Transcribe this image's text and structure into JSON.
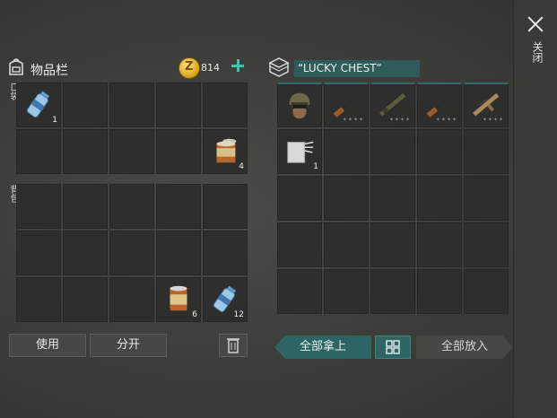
{
  "inventory": {
    "title": "物品栏",
    "coins": "814",
    "pocket_label": "口袋",
    "backpack_label": "背包",
    "pocket_items": [
      {
        "slot": 0,
        "icon": "water-bottle-icon",
        "qty": "1"
      },
      {
        "slot": 9,
        "icon": "open-canned-food-icon",
        "qty": "4"
      }
    ],
    "backpack_items": [
      {
        "slot": 13,
        "icon": "canned-food-icon",
        "qty": "6"
      },
      {
        "slot": 14,
        "icon": "water-bottle-icon",
        "qty": "12"
      }
    ]
  },
  "chest": {
    "name": "“LUCKY CHEST”",
    "items": [
      {
        "slot": 0,
        "icon": "military-helmet-icon",
        "qty": ""
      },
      {
        "slot": 1,
        "icon": "rifle-icon",
        "qty": "",
        "stars": "✦✦✦✦"
      },
      {
        "slot": 2,
        "icon": "camo-rifle-icon",
        "qty": "",
        "stars": "✦✦✦✦"
      },
      {
        "slot": 3,
        "icon": "rifle-icon",
        "qty": "",
        "stars": "✦✦✦✦"
      },
      {
        "slot": 4,
        "icon": "assault-rifle-icon",
        "qty": "",
        "stars": "✦✦✦✦"
      },
      {
        "slot": 5,
        "icon": "cloth-icon",
        "qty": "1"
      }
    ]
  },
  "buttons": {
    "use": "使用",
    "split": "分开",
    "take_all": "全部拿上",
    "put_all": "全部放入"
  },
  "close_label": "关闭",
  "colors": {
    "accent": "#2e6462",
    "plus": "#39c3b0",
    "coin": "#d7a21c"
  }
}
